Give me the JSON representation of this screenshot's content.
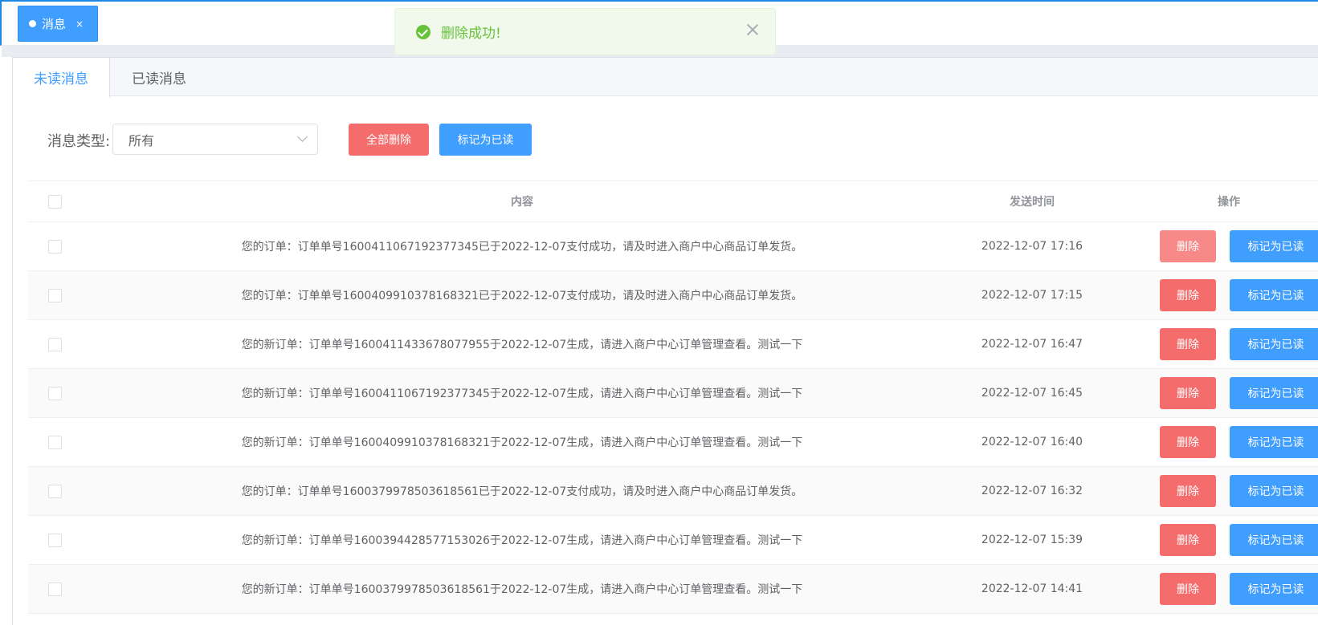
{
  "page_tag": {
    "label": "消息",
    "close": "×"
  },
  "toast": {
    "message": "删除成功!"
  },
  "tabs": [
    {
      "label": "未读消息",
      "active": true
    },
    {
      "label": "已读消息",
      "active": false
    }
  ],
  "filter": {
    "label": "消息类型:",
    "selected": "所有"
  },
  "toolbar": {
    "delete_all": "全部删除",
    "mark_read": "标记为已读"
  },
  "table": {
    "columns": [
      "内容",
      "发送时间",
      "操作"
    ],
    "rows": [
      {
        "content": "您的订单：订单单号1600411067192377345已于2022-12-07支付成功，请及时进入商户中心商品订单发货。",
        "time": "2022-12-07 17:16"
      },
      {
        "content": "您的订单：订单单号1600409910378168321已于2022-12-07支付成功，请及时进入商户中心商品订单发货。",
        "time": "2022-12-07 17:15"
      },
      {
        "content": "您的新订单：订单单号1600411433678077955于2022-12-07生成，请进入商户中心订单管理查看。测试一下",
        "time": "2022-12-07 16:47"
      },
      {
        "content": "您的新订单：订单单号1600411067192377345于2022-12-07生成，请进入商户中心订单管理查看。测试一下",
        "time": "2022-12-07 16:45"
      },
      {
        "content": "您的新订单：订单单号1600409910378168321于2022-12-07生成，请进入商户中心订单管理查看。测试一下",
        "time": "2022-12-07 16:40"
      },
      {
        "content": "您的订单：订单单号1600379978503618561已于2022-12-07支付成功，请及时进入商户中心商品订单发货。",
        "time": "2022-12-07 16:32"
      },
      {
        "content": "您的新订单：订单单号1600394428577153026于2022-12-07生成，请进入商户中心订单管理查看。测试一下",
        "time": "2022-12-07 15:39"
      },
      {
        "content": "您的新订单：订单单号1600379978503618561于2022-12-07生成，请进入商户中心订单管理查看。测试一下",
        "time": "2022-12-07 14:41"
      }
    ],
    "row_actions": {
      "delete": "删除",
      "mark_read": "标记为已读"
    }
  },
  "colors": {
    "primary": "#409eff",
    "danger": "#f56c6c",
    "success": "#67c23a"
  }
}
